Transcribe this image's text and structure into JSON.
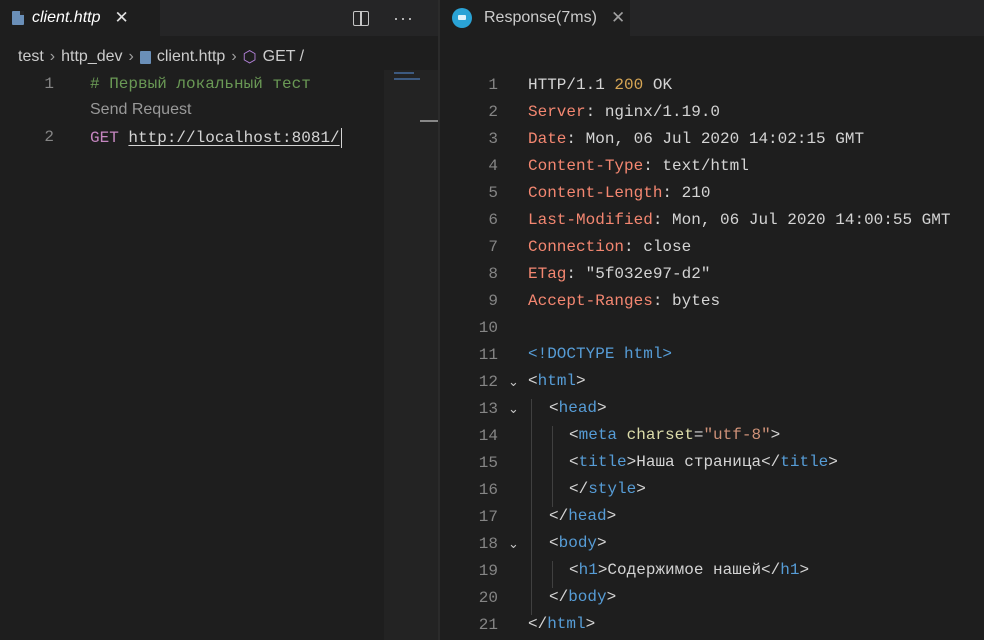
{
  "left": {
    "tab": {
      "label": "client.http"
    },
    "breadcrumb": [
      "test",
      "http_dev",
      "client.http",
      "GET /"
    ],
    "codelens": "Send Request",
    "lines": [
      {
        "num": "1",
        "comment": "# Первый локальный тест"
      },
      {
        "num": "2",
        "method": "GET",
        "url": "http://localhost:8081/"
      }
    ]
  },
  "right": {
    "tab": {
      "label": "Response(7ms)"
    },
    "status": {
      "protocol": "HTTP/1.1",
      "code": "200",
      "text": "OK"
    },
    "headers": [
      {
        "name": "Server",
        "value": "nginx/1.19.0"
      },
      {
        "name": "Date",
        "value": "Mon, 06 Jul 2020 14:02:15 GMT"
      },
      {
        "name": "Content-Type",
        "value": "text/html"
      },
      {
        "name": "Content-Length",
        "value": "210"
      },
      {
        "name": "Last-Modified",
        "value": "Mon, 06 Jul 2020 14:00:55 GMT"
      },
      {
        "name": "Connection",
        "value": "close"
      },
      {
        "name": "ETag",
        "value": "\"5f032e97-d2\""
      },
      {
        "name": "Accept-Ranges",
        "value": "bytes"
      }
    ],
    "body": {
      "doctype": "<!DOCTYPE html>",
      "html": "html",
      "head": "head",
      "meta": "meta",
      "charset_attr": "charset",
      "charset_val": "\"utf-8\"",
      "title_tag": "title",
      "title_text": "Наша страница",
      "style_tag": "style",
      "body_tag": "body",
      "h1_tag": "h1",
      "h1_text": "Содержимое нашей"
    },
    "line_numbers": [
      "1",
      "2",
      "3",
      "4",
      "5",
      "6",
      "7",
      "8",
      "9",
      "10",
      "11",
      "12",
      "13",
      "14",
      "15",
      "16",
      "17",
      "18",
      "19",
      "20",
      "21"
    ]
  }
}
